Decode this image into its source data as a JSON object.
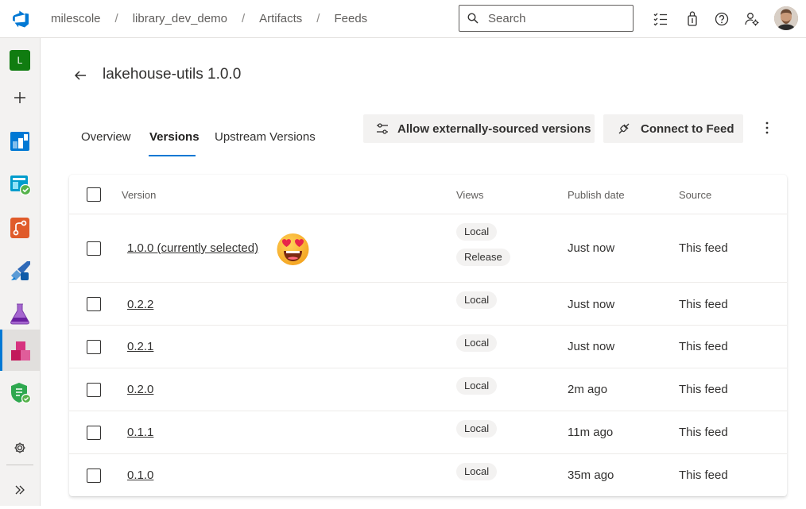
{
  "topbar": {
    "breadcrumbs": [
      "milescole",
      "library_dev_demo",
      "Artifacts",
      "Feeds"
    ],
    "search_placeholder": "Search"
  },
  "rail": {
    "project_initial": "L",
    "items": [
      "new-project",
      "boards",
      "test-plans",
      "repos",
      "pipelines",
      "test-plans-flask",
      "artifacts",
      "security"
    ],
    "active": "artifacts"
  },
  "page": {
    "title": "lakehouse-utils 1.0.0",
    "tabs": [
      "Overview",
      "Versions",
      "Upstream Versions"
    ],
    "selected_tab": "Versions",
    "buttons": {
      "allow_external": "Allow externally-sourced versions",
      "connect": "Connect to Feed"
    }
  },
  "table": {
    "columns": [
      "Version",
      "Views",
      "Publish date",
      "Source"
    ],
    "rows": [
      {
        "version": "1.0.0 (currently selected)",
        "views": [
          "Local",
          "Release"
        ],
        "date": "Just now",
        "source": "This feed"
      },
      {
        "version": "0.2.2",
        "views": [
          "Local"
        ],
        "date": "Just now",
        "source": "This feed"
      },
      {
        "version": "0.2.1",
        "views": [
          "Local"
        ],
        "date": "Just now",
        "source": "This feed"
      },
      {
        "version": "0.2.0",
        "views": [
          "Local"
        ],
        "date": "2m ago",
        "source": "This feed"
      },
      {
        "version": "0.1.1",
        "views": [
          "Local"
        ],
        "date": "11m ago",
        "source": "This feed"
      },
      {
        "version": "0.1.0",
        "views": [
          "Local"
        ],
        "date": "35m ago",
        "source": "This feed"
      }
    ]
  },
  "colors": {
    "accent": "#0078d4",
    "project_badge": "#107c10"
  }
}
